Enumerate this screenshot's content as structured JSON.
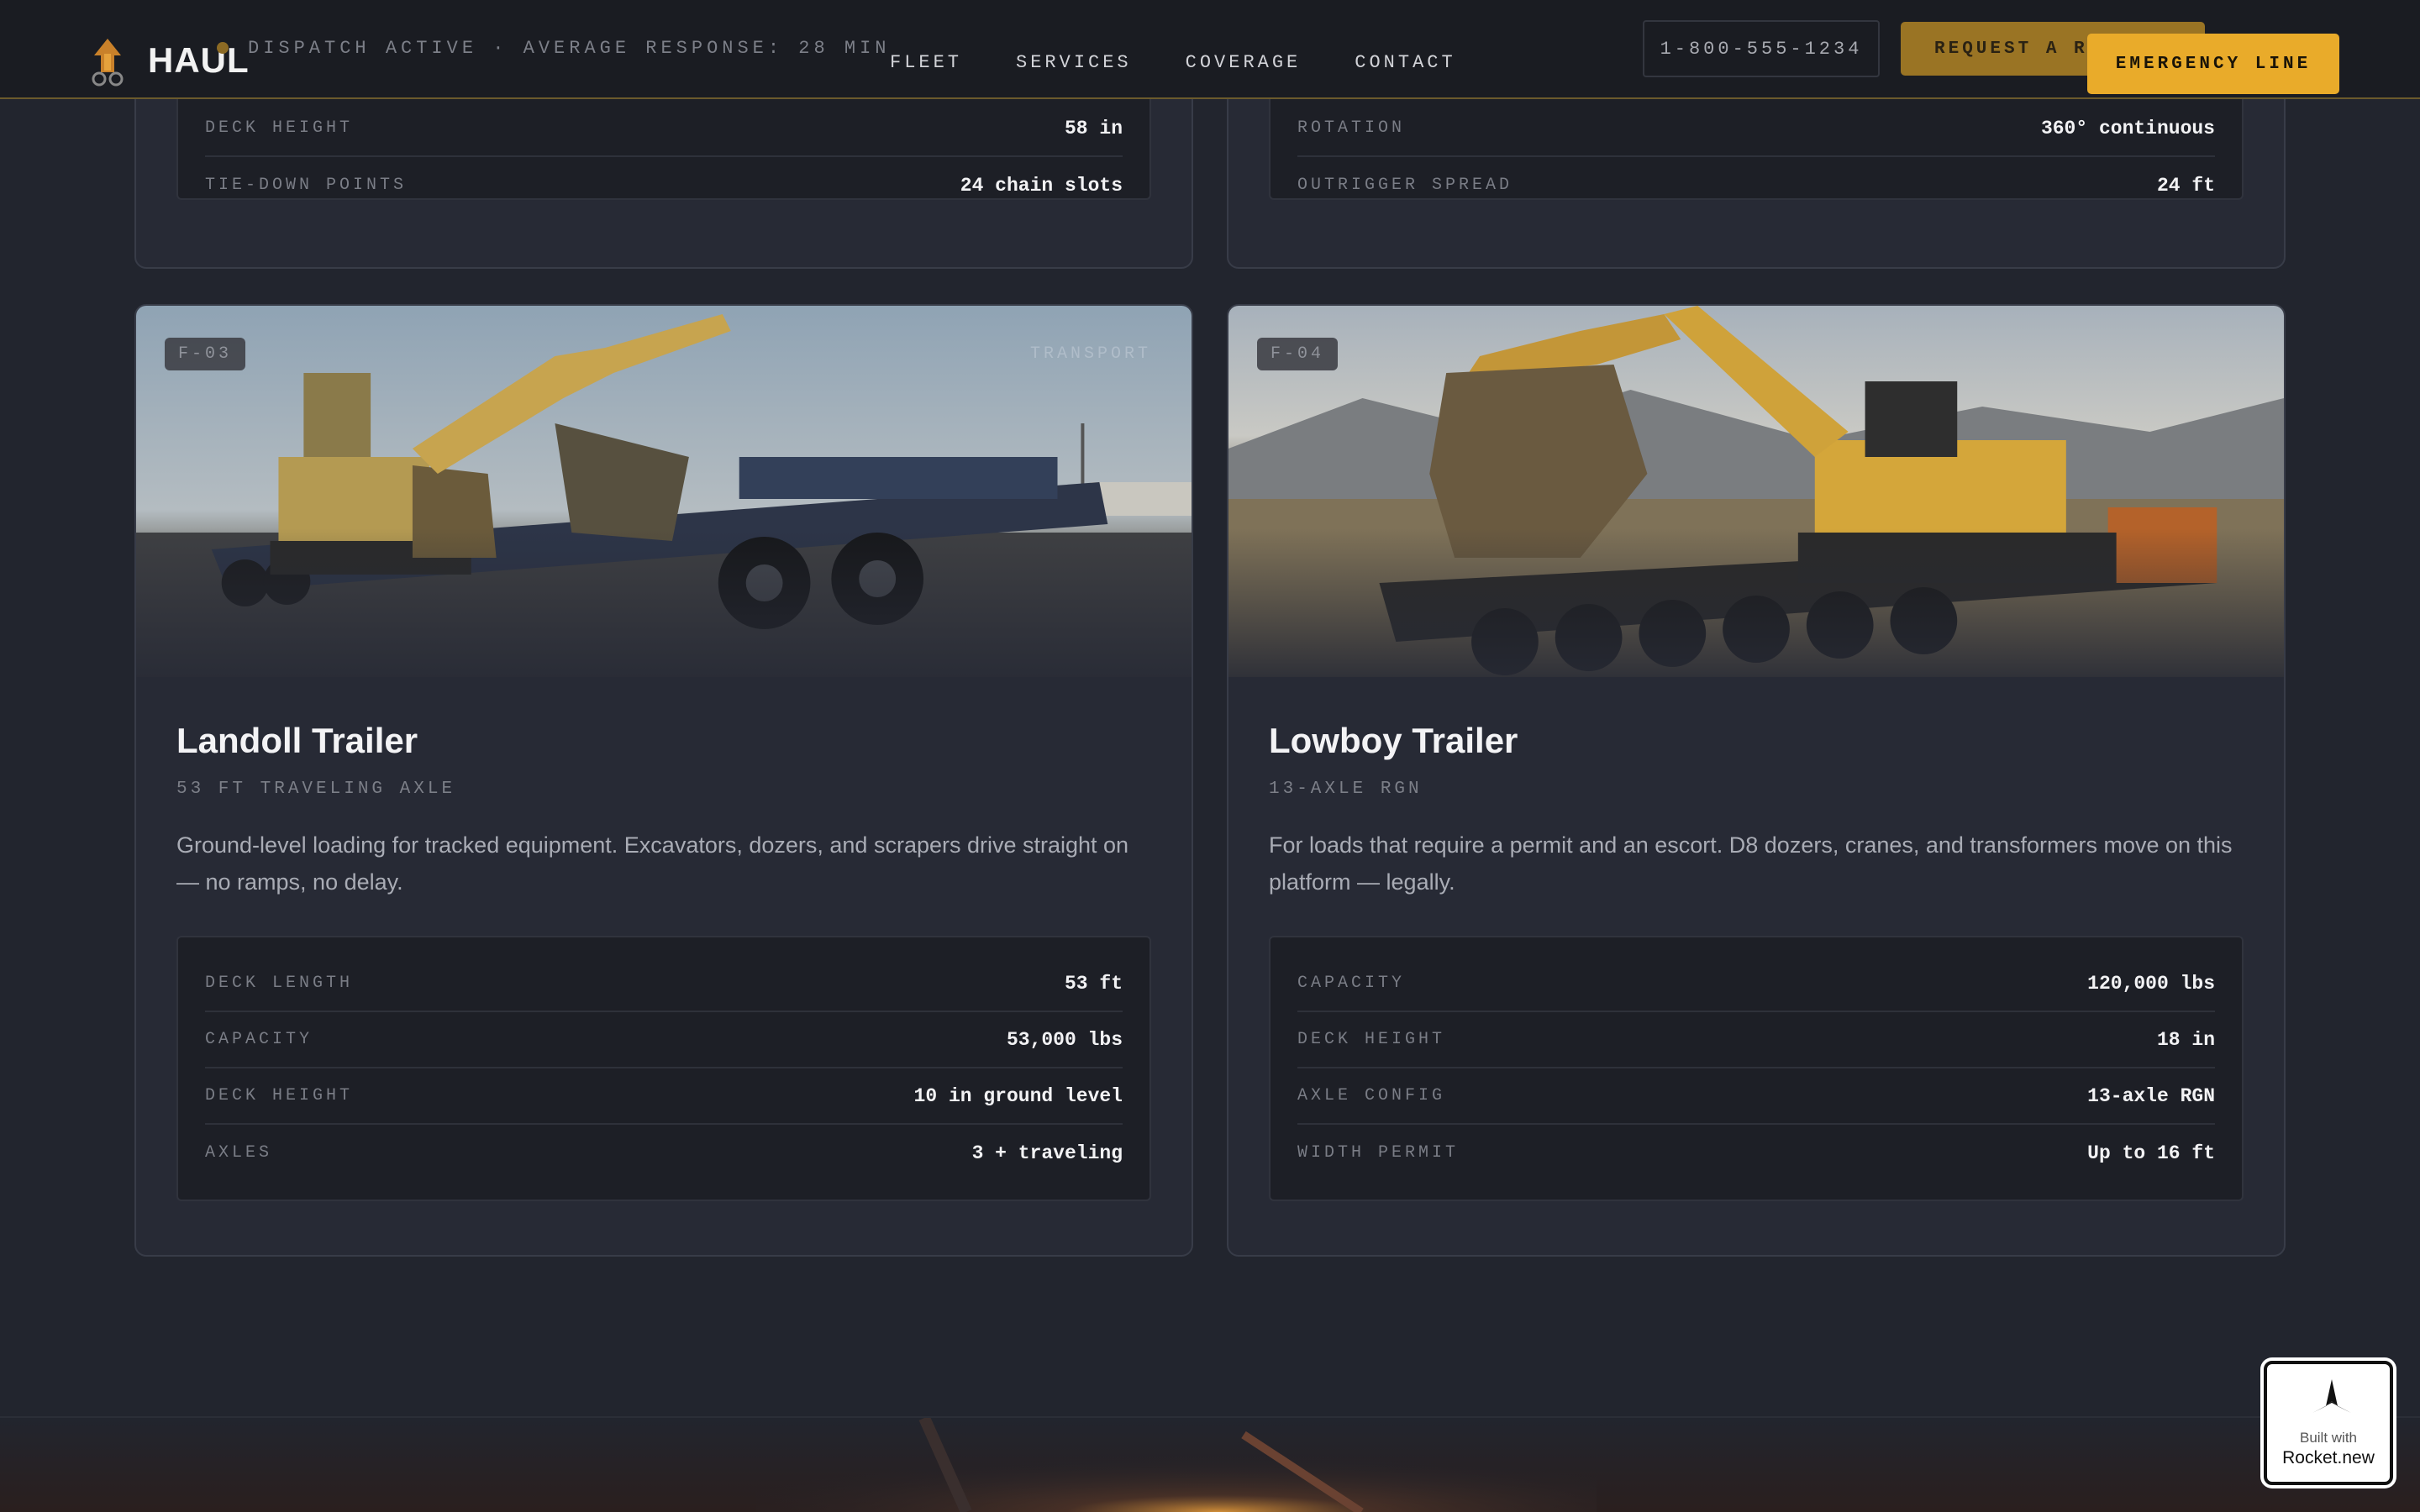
{
  "header": {
    "brand": "HAUL",
    "status": "DISPATCH ACTIVE · AVERAGE RESPONSE: 28 MIN",
    "nav": [
      "FLEET",
      "SERVICES",
      "COVERAGE",
      "CONTACT"
    ],
    "phone": "1-800-555-1234",
    "quote_button": "REQUEST A RE",
    "emergency_button": "EMERGENCY LINE"
  },
  "top_cards": [
    {
      "specs": [
        {
          "label": "DECK HEIGHT",
          "value": "58 in"
        },
        {
          "label": "TIE-DOWN POINTS",
          "value": "24 chain slots"
        }
      ]
    },
    {
      "specs": [
        {
          "label": "ROTATION",
          "value": "360° continuous"
        },
        {
          "label": "OUTRIGGER SPREAD",
          "value": "24 ft"
        }
      ]
    }
  ],
  "cards": [
    {
      "tag": "F-03",
      "category": "TRANSPORT",
      "title": "Landoll Trailer",
      "subtitle": "53 FT TRAVELING AXLE",
      "description": "Ground-level loading for tracked equipment. Excavators, dozers, and scrapers drive straight on — no ramps, no delay.",
      "specs": [
        {
          "label": "DECK LENGTH",
          "value": "53 ft"
        },
        {
          "label": "CAPACITY",
          "value": "53,000 lbs"
        },
        {
          "label": "DECK HEIGHT",
          "value": "10 in ground level"
        },
        {
          "label": "AXLES",
          "value": "3 + traveling"
        }
      ]
    },
    {
      "tag": "F-04",
      "title": "Lowboy Trailer",
      "subtitle": "13-AXLE RGN",
      "description": "For loads that require a permit and an escort. D8 dozers, cranes, and transformers move on this platform — legally.",
      "specs": [
        {
          "label": "CAPACITY",
          "value": "120,000 lbs"
        },
        {
          "label": "DECK HEIGHT",
          "value": "18 in"
        },
        {
          "label": "AXLE CONFIG",
          "value": "13-axle RGN"
        },
        {
          "label": "WIDTH PERMIT",
          "value": "Up to 16 ft"
        }
      ]
    }
  ],
  "badge": {
    "line1": "Built with",
    "line2": "Rocket.new"
  },
  "colors": {
    "accent": "#e9ab2a",
    "background": "#22252e",
    "card": "#272a35"
  },
  "icons": [
    "haul-logo-icon",
    "rocket-icon"
  ]
}
